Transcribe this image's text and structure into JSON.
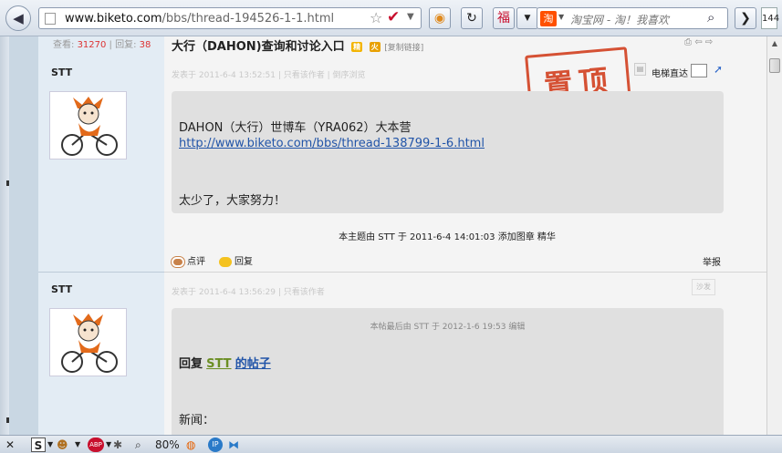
{
  "browser": {
    "url_domain": "www.biketo.com",
    "url_path": "/bbs/thread-194526-1-1.html",
    "search_placeholder": "淘宝网 - 淘！我喜欢",
    "search_engine_label": "淘",
    "tab_count": "144",
    "zoom": "80%"
  },
  "thread": {
    "views_label": "查看:",
    "views": "31270",
    "replies_label": "回复:",
    "replies": "38",
    "title": "大行（DAHON)查询和讨论入口",
    "copy_link": "[复制链接]",
    "stamp": "置顶"
  },
  "posts": [
    {
      "author": "STT",
      "meta": "发表于 2011-6-4 13:52:51 | 只看该作者 | 倒序浏览",
      "lift_label": "电梯直达",
      "lines": [
        "DAHON（大行）世博车（YRA062）大本营",
        "http://www.biketo.com/bbs/thread-138799-1-6.html",
        "太少了，大家努力！"
      ],
      "moderation_notice": "本主题由 STT 于 2011-6-4 14:01:03 添加图章 精华",
      "actions": {
        "rate": "点评",
        "reply": "回复",
        "report": "举报"
      }
    },
    {
      "author": "STT",
      "meta": "发表于 2011-6-4 13:56:29 | 只看该作者",
      "floor": "沙发",
      "edit_notice": "本帖最后由 STT 于 2012-1-6 19:53 编辑",
      "reply_prefix": "回复",
      "reply_user": "STT",
      "reply_suffix": "的帖子",
      "news_label": "新闻："
    }
  ],
  "colors": {
    "accent_red": "#d24020",
    "link_blue": "#2154a8",
    "reply_green": "#6b8e23",
    "views_red": "#dd3333"
  }
}
